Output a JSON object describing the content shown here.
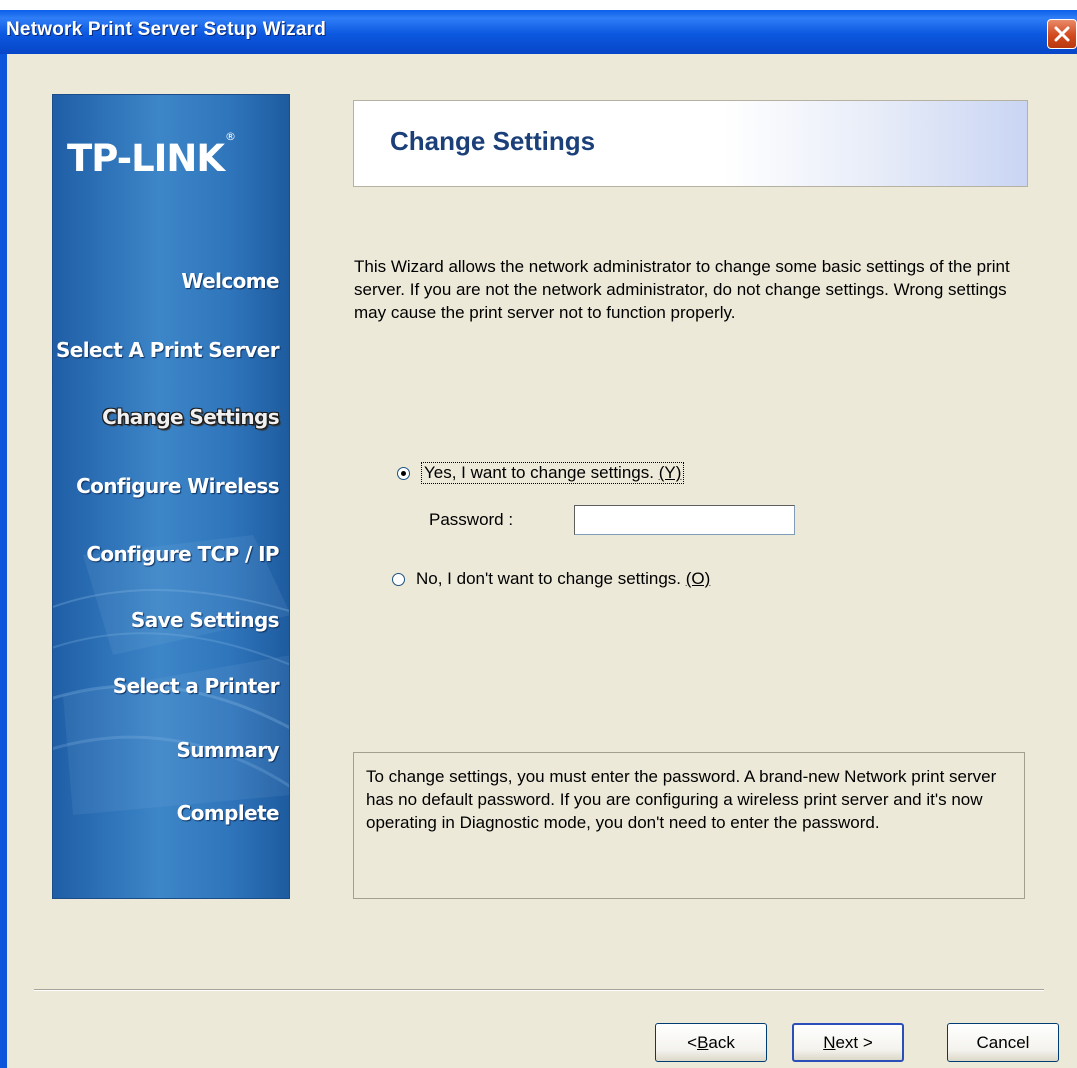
{
  "window": {
    "title": "Network Print Server Setup Wizard",
    "close_icon": "close-icon"
  },
  "sidebar": {
    "logo": "TP-LINK",
    "logo_mark": "®",
    "steps": [
      {
        "label": "Welcome",
        "active": false
      },
      {
        "label": "Select A Print Server",
        "active": false
      },
      {
        "label": "Change Settings",
        "active": true
      },
      {
        "label": "Configure Wireless",
        "active": false
      },
      {
        "label": "Configure TCP / IP",
        "active": false
      },
      {
        "label": "Save Settings",
        "active": false
      },
      {
        "label": "Select a Printer",
        "active": false
      },
      {
        "label": "Summary",
        "active": false
      },
      {
        "label": "Complete",
        "active": false
      }
    ]
  },
  "main": {
    "header_title": "Change Settings",
    "intro": "This Wizard allows the network administrator to change some basic settings of the print server. If you are not the network administrator, do not change settings. Wrong settings may cause the print server not to function properly.",
    "options": {
      "yes_label": "Yes, I want to change settings. ",
      "yes_accel": "(Y)",
      "no_label": "No, I don't want to change settings. ",
      "no_accel": "(O)",
      "selected": "yes"
    },
    "password_label": "Password :",
    "password_value": "",
    "note": "To change settings, you must enter the password. A brand-new Network print server has no default password. If you are configuring a wireless print server and it's now operating in Diagnostic mode, you don't need to enter the password."
  },
  "buttons": {
    "back_prefix": "< ",
    "back_accel": "B",
    "back_rest": "ack",
    "next_accel": "N",
    "next_rest": "ext >",
    "cancel": "Cancel"
  },
  "colors": {
    "titlebar": "#0b58e0",
    "sidepanel": "#3d86c8",
    "header_title": "#1b3f78",
    "dialog_bg": "#ece9d8"
  }
}
